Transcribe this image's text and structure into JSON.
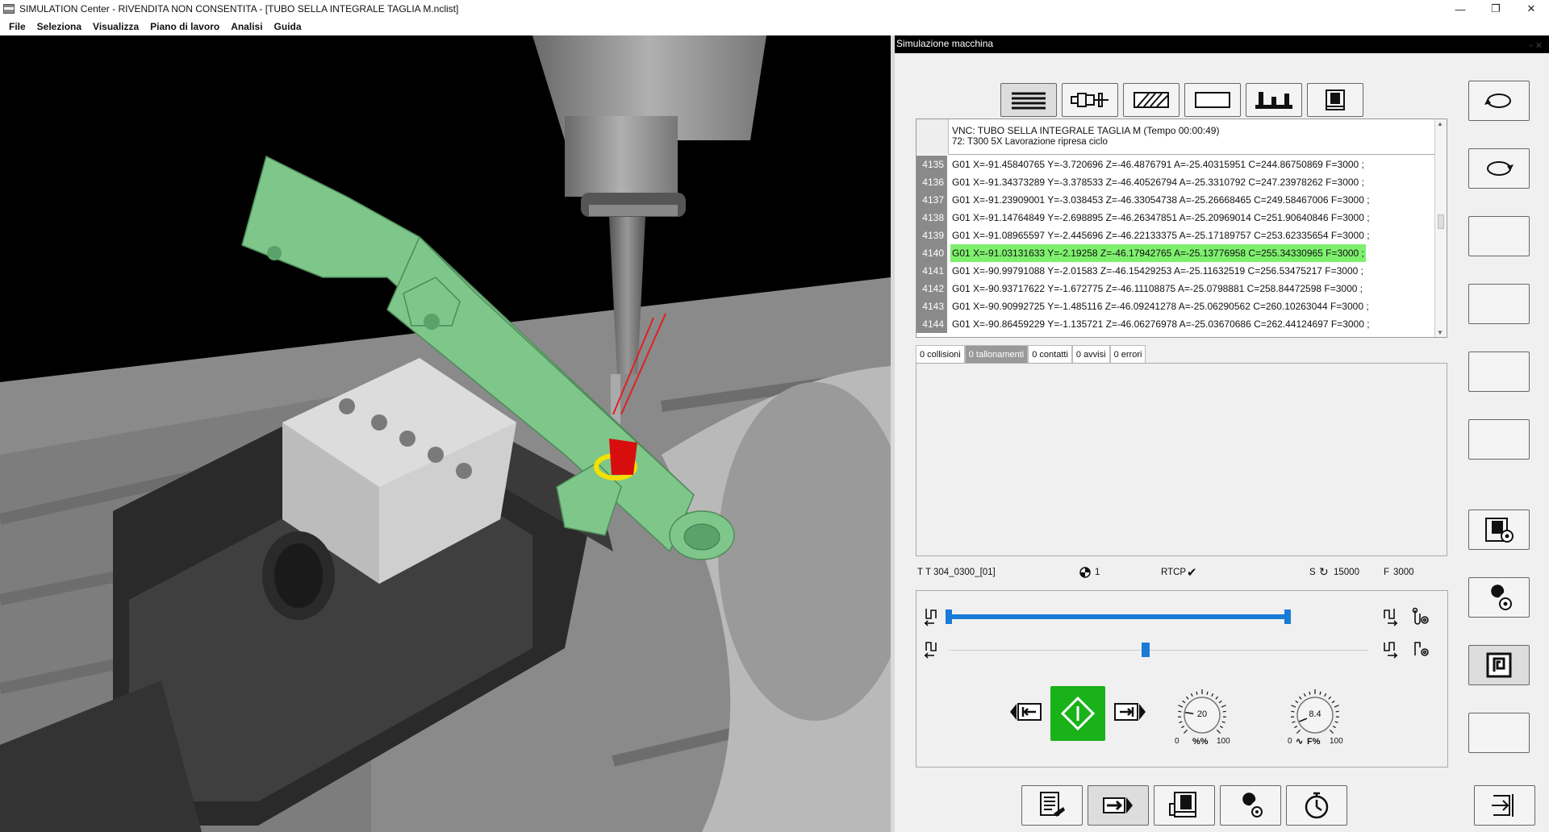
{
  "window": {
    "title": "SIMULATION Center - RIVENDITA NON CONSENTITA - [TUBO SELLA INTEGRALE TAGLIA M.nclist]",
    "controls": [
      "minimize-icon",
      "maximize-icon",
      "close-icon"
    ]
  },
  "menu": [
    "File",
    "Seleziona",
    "Visualizza",
    "Piano di lavoro",
    "Analisi",
    "Guida"
  ],
  "panel": {
    "title": "Simulazione macchina",
    "toolbar_icons": [
      "nc-code-icon",
      "tool-icon",
      "stock-icon",
      "blank-icon",
      "fixture-icon",
      "machine-icon"
    ],
    "code_header": {
      "line1": "VNC: TUBO SELLA INTEGRALE TAGLIA M (Tempo 00:00:49)",
      "line2": "72: T300 5X Lavorazione ripresa ciclo"
    },
    "code_lines": [
      {
        "n": "4135",
        "text": "G01 X=-91.45840765 Y=-3.720696 Z=-46.4876791 A=-25.40315951 C=244.86750869 F=3000 ;",
        "hl": false
      },
      {
        "n": "4136",
        "text": "G01 X=-91.34373289 Y=-3.378533 Z=-46.40526794 A=-25.3310792 C=247.23978262 F=3000 ;",
        "hl": false
      },
      {
        "n": "4137",
        "text": "G01 X=-91.23909001 Y=-3.038453 Z=-46.33054738 A=-25.26668465 C=249.58467006 F=3000 ;",
        "hl": false
      },
      {
        "n": "4138",
        "text": "G01 X=-91.14764849 Y=-2.698895 Z=-46.26347851 A=-25.20969014 C=251.90640846 F=3000 ;",
        "hl": false
      },
      {
        "n": "4139",
        "text": "G01 X=-91.08965597 Y=-2.445696 Z=-46.22133375 A=-25.17189757 C=253.62335654 F=3000 ;",
        "hl": false
      },
      {
        "n": "4140",
        "text": "G01 X=-91.03131633 Y=-2.19258 Z=-46.17942765 A=-25.13776958 C=255.34330965 F=3000 ;",
        "hl": true
      },
      {
        "n": "4141",
        "text": "G01 X=-90.99791088 Y=-2.01583 Z=-46.15429253 A=-25.11632519 C=256.53475217 F=3000 ;",
        "hl": false
      },
      {
        "n": "4142",
        "text": "G01 X=-90.93717622 Y=-1.672775 Z=-46.11108875 A=-25.0798881 C=258.84472598 F=3000 ;",
        "hl": false
      },
      {
        "n": "4143",
        "text": "G01 X=-90.90992725 Y=-1.485116 Z=-46.09241278 A=-25.06290562 C=260.10263044 F=3000 ;",
        "hl": false
      },
      {
        "n": "4144",
        "text": "G01 X=-90.86459229 Y=-1.135721 Z=-46.06276978 A=-25.03670686 C=262.44124697 F=3000 ;",
        "hl": false
      }
    ],
    "tabs": [
      "0 collisioni",
      "0 tallonamenti",
      "0 contatti",
      "0 avvisi",
      "0 errori"
    ],
    "active_tab": 1,
    "status": {
      "tool_prefix": "T",
      "tool": "T 304_0300_[01]",
      "origin": "1",
      "rtcp": "RTCP",
      "spindle_label": "S",
      "spindle_value": "15000",
      "feed_label": "F",
      "feed_value": "3000"
    },
    "sim": {
      "progress": 1.0,
      "speed_slider": 0.47,
      "knob1": {
        "value": "20",
        "min": "0",
        "max": "100",
        "label": "%%",
        "level": 0.2
      },
      "knob2": {
        "value": "8.4",
        "min": "0",
        "max": "100",
        "label": "F%",
        "level": 0.084
      }
    },
    "bottom_icons": [
      "report-icon",
      "play-to-icon",
      "machine-view-icon",
      "tool-settings-icon",
      "stopwatch-icon",
      "exit-icon"
    ],
    "right_icons": [
      "rotate-ccw-icon",
      "rotate-cw-icon",
      "empty",
      "empty",
      "empty",
      "empty",
      "machine-gear-icon",
      "wrench-gear-icon",
      "frame-icon",
      "empty"
    ],
    "accent": "#1a7bd6",
    "run_button_color": "#19b219",
    "highlight_color": "#7ef06e"
  }
}
